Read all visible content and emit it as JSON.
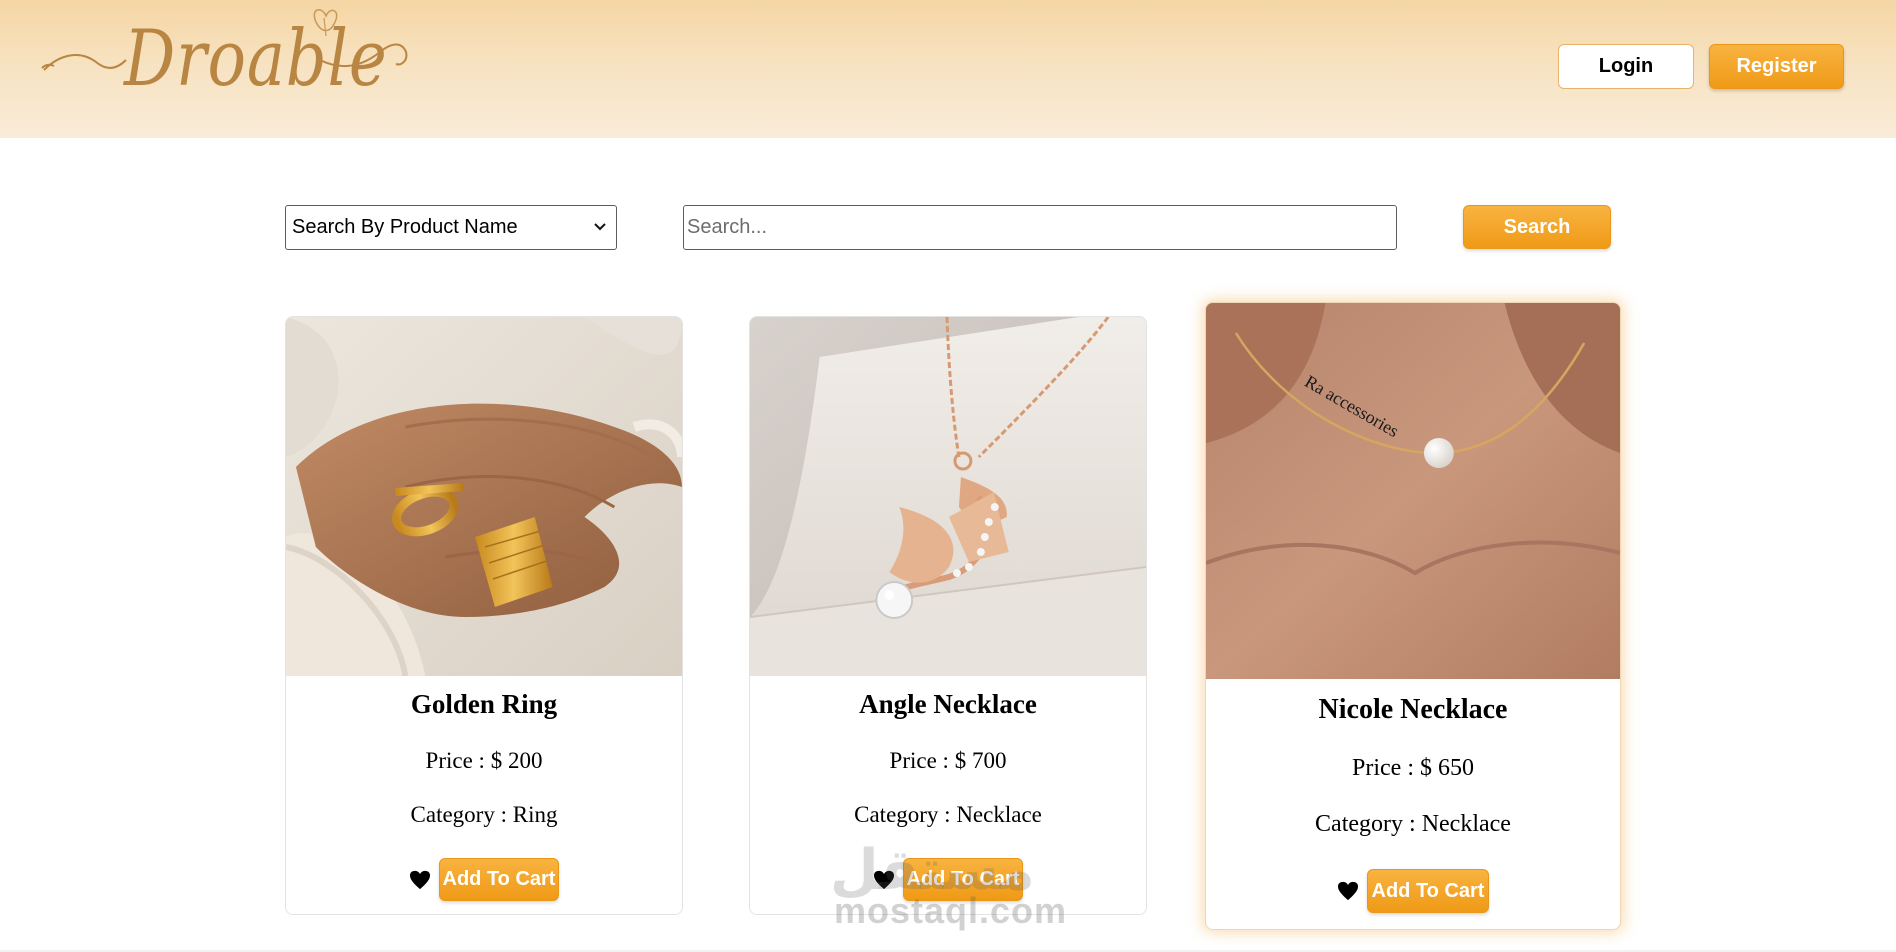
{
  "brand": {
    "name": "Droable",
    "logo_color": "#b98542"
  },
  "header": {
    "login_label": "Login",
    "register_label": "Register"
  },
  "search": {
    "select_value": "Search By Product Name",
    "placeholder": "Search...",
    "button_label": "Search"
  },
  "products": [
    {
      "name": "Golden Ring",
      "price": "Price : $ 200",
      "category": "Category : Ring",
      "cart_label": "Add To Cart"
    },
    {
      "name": "Angle Necklace",
      "price": "Price : $ 700",
      "category": "Category : Necklace",
      "cart_label": "Add To Cart"
    },
    {
      "name": "Nicole Necklace",
      "price": "Price : $ 650",
      "category": "Category : Necklace",
      "cart_label": "Add To Cart"
    }
  ],
  "watermark": {
    "domain": "mostaql.com",
    "arabic": "مستقل"
  },
  "colors": {
    "accent": "#f0a020",
    "header_bg": "#f7e0bc"
  }
}
